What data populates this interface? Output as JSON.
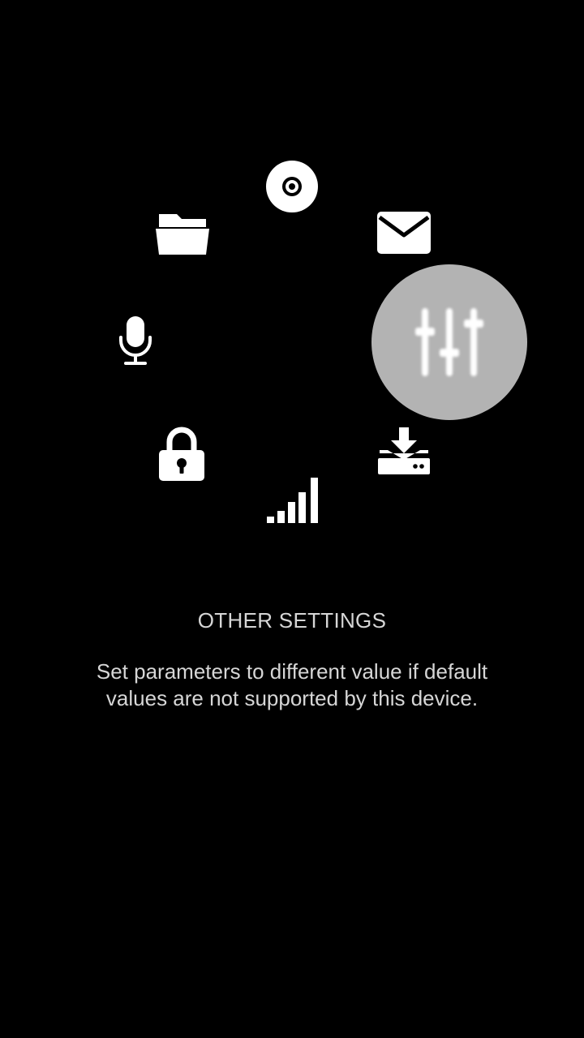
{
  "menu": {
    "items": [
      {
        "id": "disc",
        "icon": "disc-icon"
      },
      {
        "id": "mail",
        "icon": "mail-icon"
      },
      {
        "id": "equalizer",
        "icon": "equalizer-sliders-icon",
        "selected": true
      },
      {
        "id": "download",
        "icon": "download-drive-icon"
      },
      {
        "id": "signal",
        "icon": "signal-bars-icon"
      },
      {
        "id": "lock",
        "icon": "lock-icon"
      },
      {
        "id": "microphone",
        "icon": "microphone-icon"
      },
      {
        "id": "folder",
        "icon": "folder-icon"
      }
    ],
    "selected_highlight_color": "#b3b3b3",
    "icon_color": "#ffffff",
    "background_color": "#000000"
  },
  "info": {
    "title": "OTHER SETTINGS",
    "description": "Set parameters to different value if default values are not supported by this device.",
    "text_color": "#d6d6d6"
  }
}
